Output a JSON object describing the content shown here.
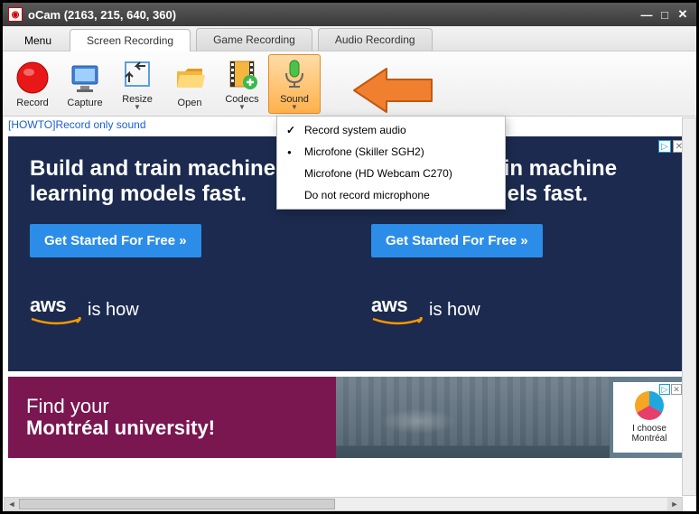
{
  "title": "oCam (2163, 215, 640, 360)",
  "menu": {
    "label": "Menu"
  },
  "tabs": [
    {
      "label": "Screen Recording",
      "active": true
    },
    {
      "label": "Game Recording",
      "active": false
    },
    {
      "label": "Audio Recording",
      "active": false
    }
  ],
  "toolbar": {
    "record": "Record",
    "capture": "Capture",
    "resize": "Resize",
    "open": "Open",
    "codecs": "Codecs",
    "sound": "Sound"
  },
  "howto": "[HOWTO]Record only sound",
  "sound_menu": [
    {
      "label": "Record system audio",
      "mark": "check"
    },
    {
      "label": "Microfone (Skiller SGH2)",
      "mark": "dot"
    },
    {
      "label": "Microfone (HD Webcam C270)",
      "mark": ""
    },
    {
      "label": "Do not record microphone",
      "mark": ""
    }
  ],
  "ad_aws": {
    "headline": "Build and train machine learning models fast.",
    "cta": "Get Started For Free »",
    "aws": "aws",
    "ishow": "is how"
  },
  "ad_banner": {
    "line1": "Find your",
    "line2": "Montréal university!",
    "right1": "I choose",
    "right2": "Montréal"
  }
}
